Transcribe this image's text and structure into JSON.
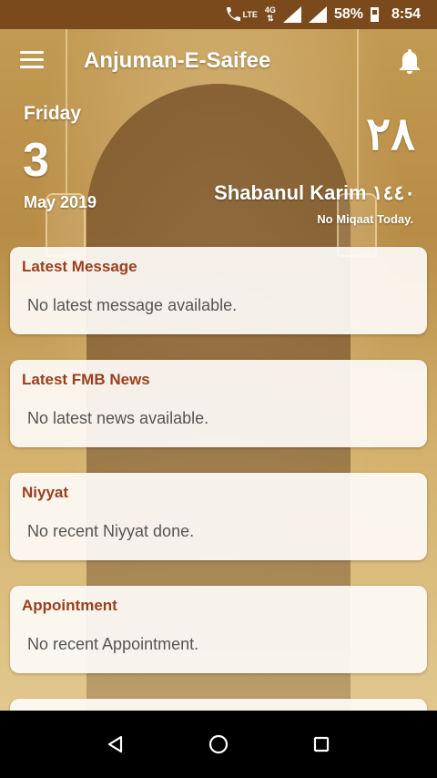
{
  "status_bar": {
    "network_lte": "LTE",
    "network_4g": "4G",
    "battery_percent": "58%",
    "time": "8:54",
    "battery_level": 0.58
  },
  "app_bar": {
    "title": "Anjuman-E-Saifee",
    "menu_icon": "menu-icon",
    "notification_icon": "bell-icon"
  },
  "date": {
    "day_name": "Friday",
    "day_number": "3",
    "month_year": "May 2019",
    "hijri_day": "٢٨",
    "hijri_month": "Shabanul Karim ١٤٤٠",
    "miqaat": "No Miqaat Today."
  },
  "cards": [
    {
      "title": "Latest Message",
      "body": "No latest message available."
    },
    {
      "title": "Latest FMB News",
      "body": "No latest news available."
    },
    {
      "title": "Niyyat",
      "body": "No recent Niyyat done."
    },
    {
      "title": "Appointment",
      "body": "No recent Appointment."
    }
  ],
  "colors": {
    "status_bar": "#7a4a1c",
    "card_title": "#9a3f1e",
    "card_body": "#555555",
    "card_bg": "#fdfaf6"
  },
  "nav": {
    "back_icon": "back-triangle-icon",
    "home_icon": "home-circle-icon",
    "recents_icon": "recents-square-icon"
  }
}
